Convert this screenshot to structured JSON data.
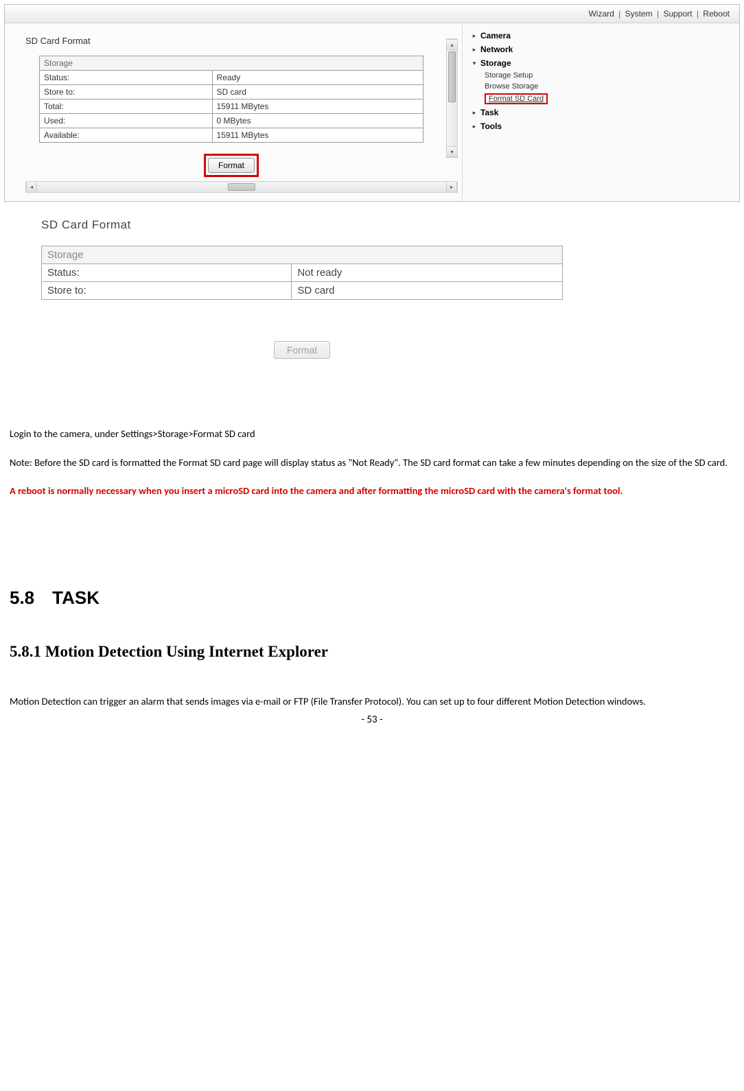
{
  "topMenu": {
    "wizard": "Wizard",
    "system": "System",
    "support": "Support",
    "reboot": "Reboot",
    "sep": "|"
  },
  "ss1": {
    "title": "SD Card Format",
    "tableHeader": "Storage",
    "rows": [
      {
        "k": "Status:",
        "v": "Ready"
      },
      {
        "k": "Store to:",
        "v": "SD card"
      },
      {
        "k": "Total:",
        "v": "15911 MBytes"
      },
      {
        "k": "Used:",
        "v": "0 MBytes"
      },
      {
        "k": "Available:",
        "v": "15911 MBytes"
      }
    ],
    "formatBtn": "Format"
  },
  "sideNav": {
    "camera": "Camera",
    "network": "Network",
    "storage": "Storage",
    "storageSetup": "Storage Setup",
    "browseStorage": "Browse Storage",
    "formatSD": "Format SD Card",
    "task": "Task",
    "tools": "Tools"
  },
  "ss2": {
    "title": "SD Card Format",
    "tableHeader": "Storage",
    "rows": [
      {
        "k": "Status:",
        "v": "Not ready"
      },
      {
        "k": "Store to:",
        "v": "SD card"
      }
    ],
    "formatBtn": "Format"
  },
  "doc": {
    "p1": "Login to the camera, under Settings>Storage>Format SD card",
    "p2": "Note: Before the SD card is formatted the Format SD card page will display status as \"Not Ready\". The SD card format can take a few minutes depending on the size of the SD card.",
    "warn": "A reboot is normally necessary when you insert a microSD card into the camera and after formatting the microSD card with the camera's format tool.",
    "h58": "5.8 TASK",
    "h581": "5.8.1 Motion Detection Using Internet Explorer",
    "p3": "Motion Detection can trigger an alarm that sends images via e-mail or FTP (File Transfer Protocol). You can set up to four different Motion Detection windows.",
    "pager": "- 53 -"
  },
  "glyphs": {
    "right": "▸",
    "down": "▾",
    "up": "▴",
    "left": "◂"
  }
}
